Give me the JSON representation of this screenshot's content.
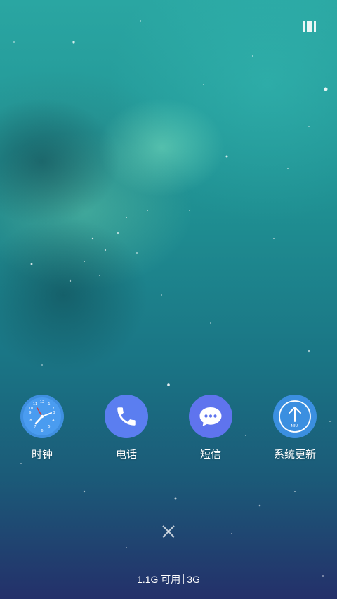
{
  "recent_apps": [
    {
      "label": "时钟",
      "icon": "clock-icon",
      "color": "#3f8fe0"
    },
    {
      "label": "电话",
      "icon": "phone-icon",
      "color": "#5b7ef0"
    },
    {
      "label": "短信",
      "icon": "message-icon",
      "color": "#5f74ee"
    },
    {
      "label": "系统更新",
      "icon": "update-icon",
      "color": "#3b8fe0"
    }
  ],
  "update_icon_text": "MIUI",
  "memory": {
    "available": "1.1G 可用",
    "network": "3G"
  }
}
